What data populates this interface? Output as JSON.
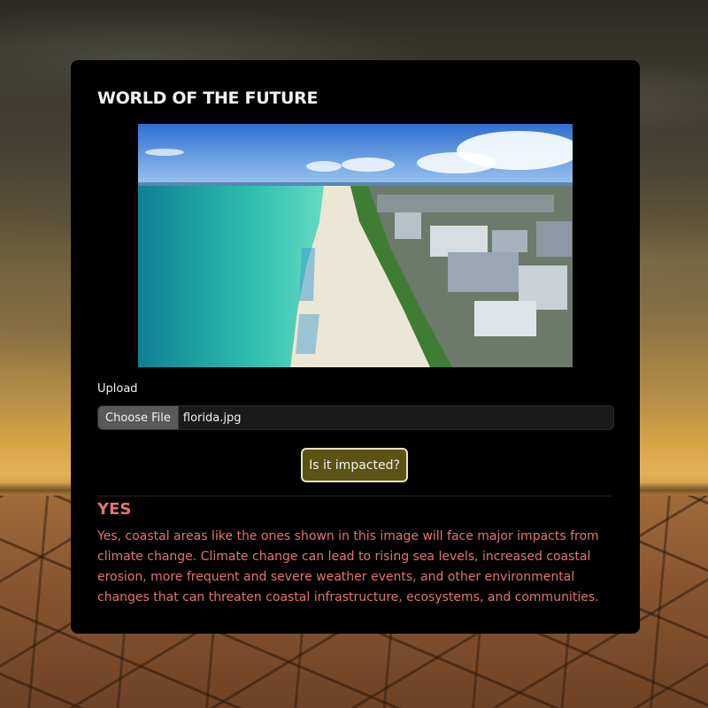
{
  "app": {
    "title": "WORLD OF THE FUTURE"
  },
  "preview": {
    "image_name": "florida-beach-photo"
  },
  "upload": {
    "label": "Upload",
    "choose_label": "Choose File",
    "file_name": "florida.jpg"
  },
  "action": {
    "submit_label": "Is it impacted?"
  },
  "result": {
    "verdict": "YES",
    "explanation": "Yes, coastal areas like the ones shown in this image will face major impacts from climate change. Climate change can lead to rising sea levels, increased coastal erosion, more frequent and severe weather events, and other environmental changes that can threaten coastal infrastructure, ecosystems, and communities."
  },
  "colors": {
    "card_bg": "#000000",
    "accent_button": "#5a5414",
    "result_text": "#e57373"
  }
}
